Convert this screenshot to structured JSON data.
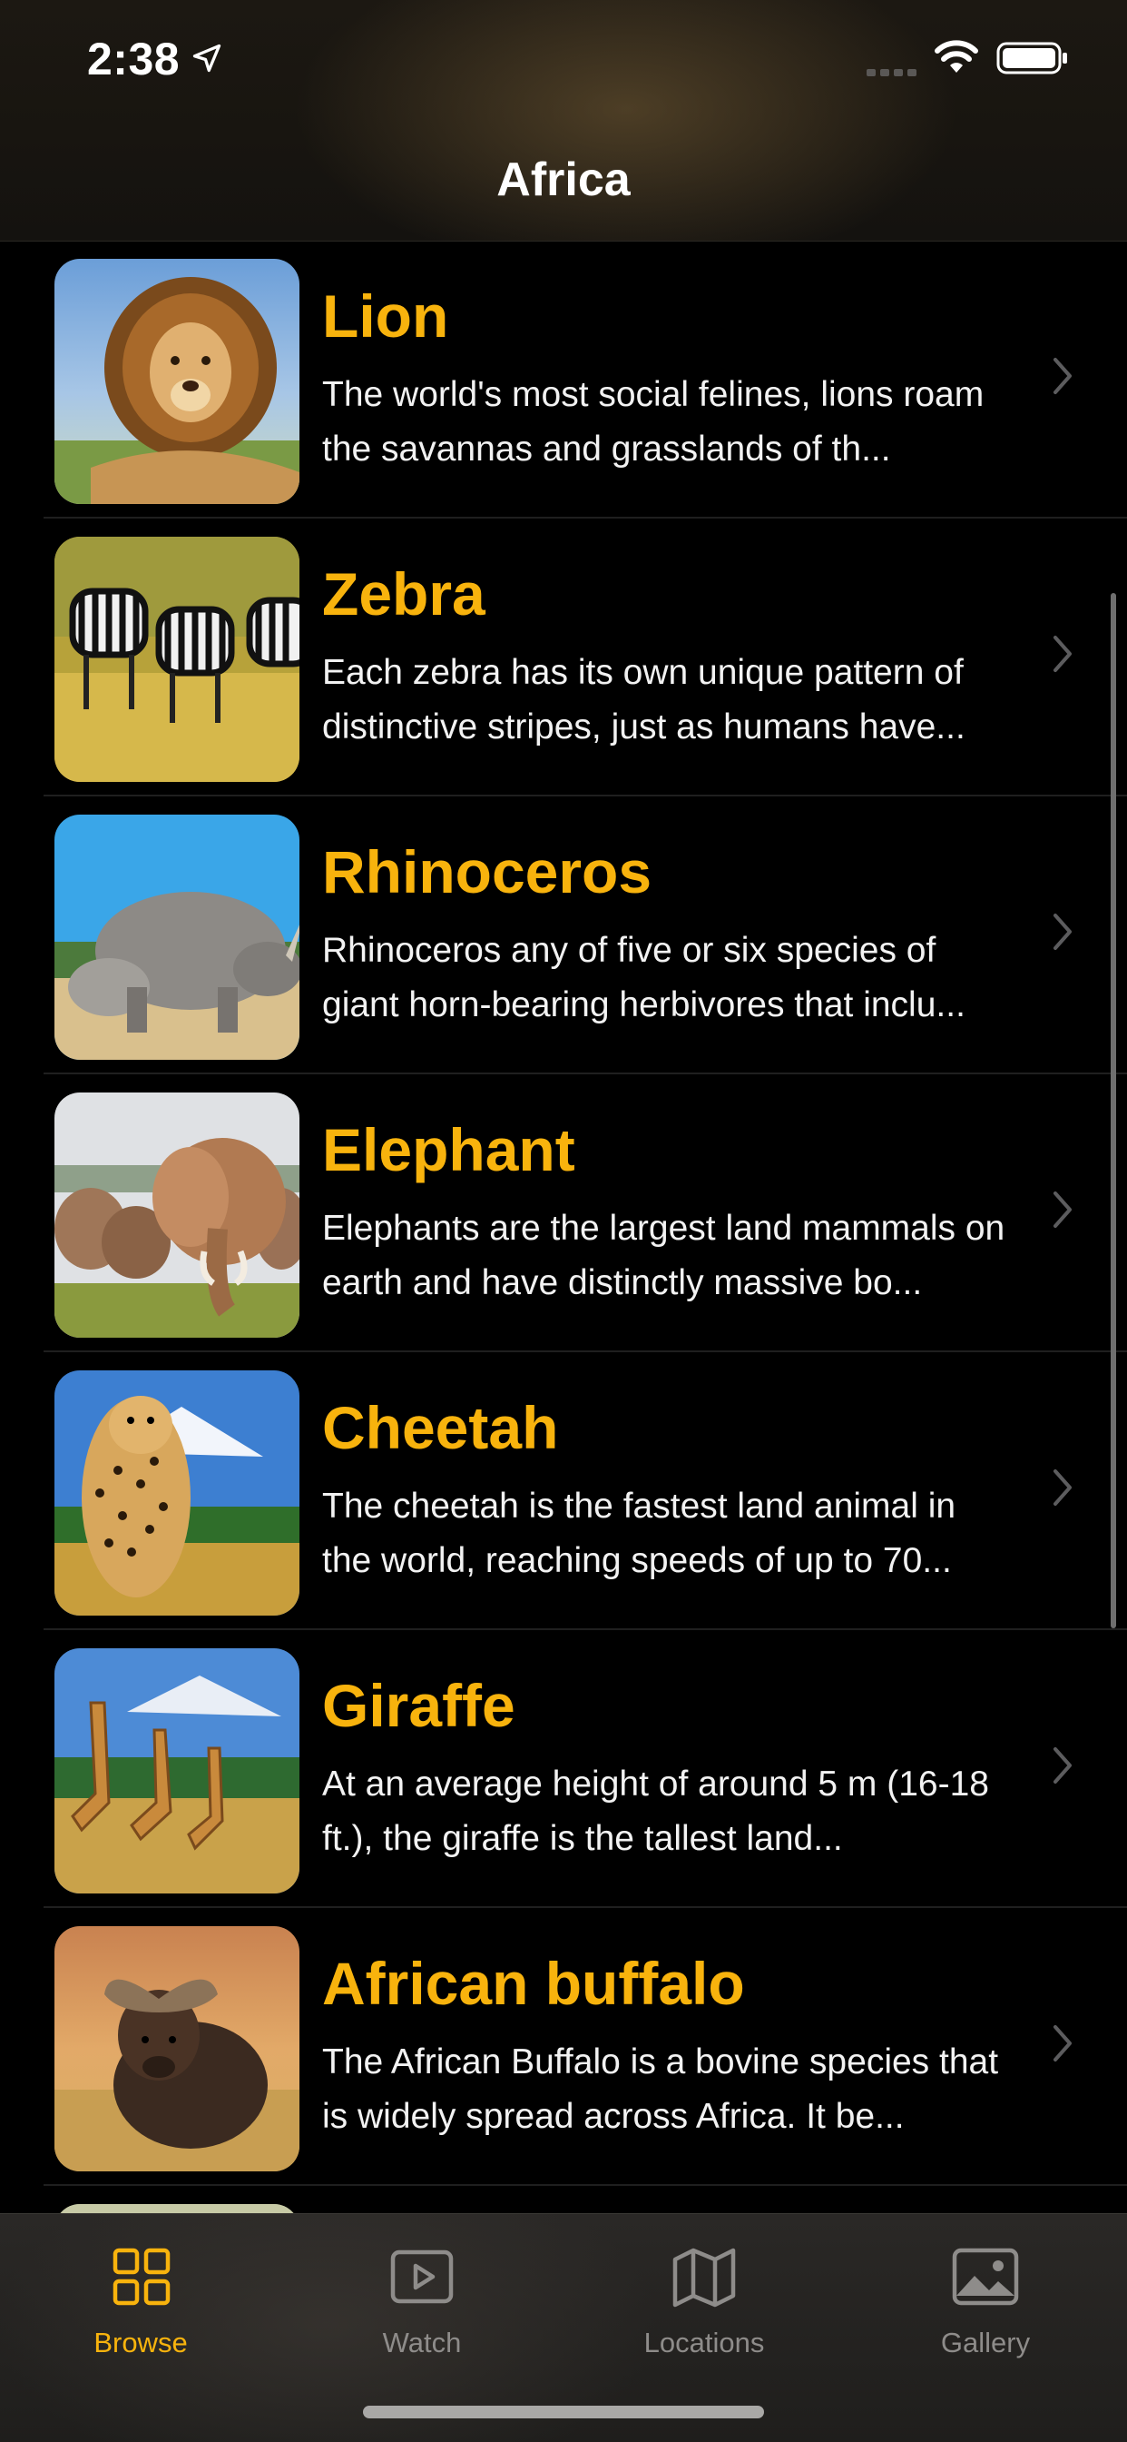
{
  "status_bar": {
    "time": "2:38"
  },
  "nav": {
    "title": "Africa"
  },
  "colors": {
    "accent": "#f8b30d",
    "background": "#000000",
    "tab_inactive": "#8e8c8a"
  },
  "animals": [
    {
      "name": "Lion",
      "description": "The world's most social felines, lions roam the savannas and grasslands of th...",
      "image_icon": "lion-photo"
    },
    {
      "name": "Zebra",
      "description": "Each zebra has its own unique pattern of distinctive stripes, just as humans have...",
      "image_icon": "zebra-photo"
    },
    {
      "name": "Rhinoceros",
      "description": "Rhinoceros any of five or six species of giant horn-bearing herbivores that inclu...",
      "image_icon": "rhinoceros-photo"
    },
    {
      "name": "Elephant",
      "description": "Elephants are the largest land mammals on earth and have distinctly massive bo...",
      "image_icon": "elephant-photo"
    },
    {
      "name": "Cheetah",
      "description": "The cheetah is the fastest land animal in the world, reaching speeds of up to 70...",
      "image_icon": "cheetah-photo"
    },
    {
      "name": "Giraffe",
      "description": "At an average height of around 5 m (16-18 ft.), the giraffe is the tallest land...",
      "image_icon": "giraffe-photo"
    },
    {
      "name": "African buffalo",
      "description": "The African Buffalo is a bovine species that is widely spread across Africa. It be...",
      "image_icon": "buffalo-photo"
    }
  ],
  "tabs": [
    {
      "label": "Browse",
      "icon": "grid-icon",
      "active": true
    },
    {
      "label": "Watch",
      "icon": "play-icon",
      "active": false
    },
    {
      "label": "Locations",
      "icon": "map-icon",
      "active": false
    },
    {
      "label": "Gallery",
      "icon": "photo-icon",
      "active": false
    }
  ]
}
